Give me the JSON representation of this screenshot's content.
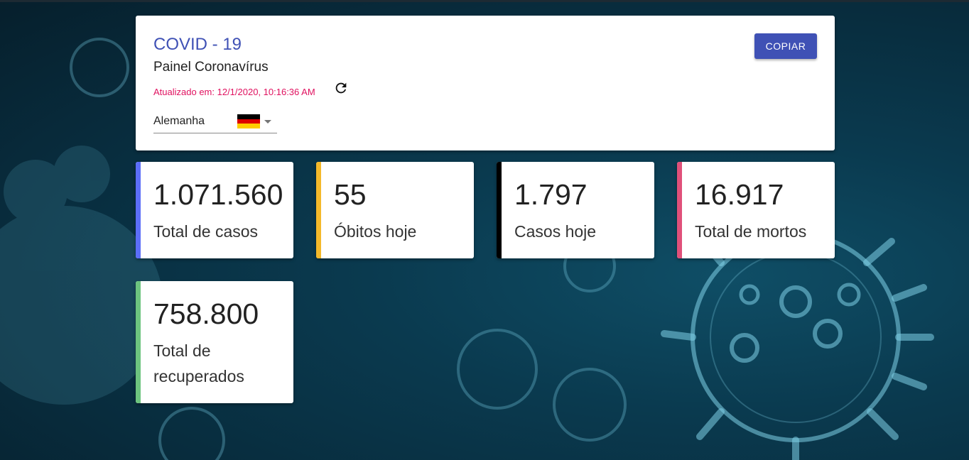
{
  "header": {
    "title": "COVID - 19",
    "subtitle": "Painel Coronavírus",
    "updated": "Atualizado em: 12/1/2020, 10:16:36 AM",
    "copy_label": "COPIAR",
    "refresh_icon": "refresh-icon"
  },
  "country": {
    "selected": "Alemanha",
    "flag_icon": "germany-flag-icon",
    "flag_colors": [
      "#000000",
      "#dd0000",
      "#ffce00"
    ]
  },
  "stats": [
    {
      "value": "1.071.560",
      "label": "Total de casos",
      "color": "#5c6ef8"
    },
    {
      "value": "55",
      "label": "Óbitos hoje",
      "color": "#f4b92a"
    },
    {
      "value": "1.797",
      "label": "Casos hoje",
      "color": "#000000"
    },
    {
      "value": "16.917",
      "label": "Total de mortos",
      "color": "#e0507a"
    },
    {
      "value": "758.800",
      "label": "Total de recuperados",
      "color": "#6dc47f"
    }
  ],
  "colors": {
    "primary": "#3f51b5",
    "updated_text": "#e0115f"
  }
}
